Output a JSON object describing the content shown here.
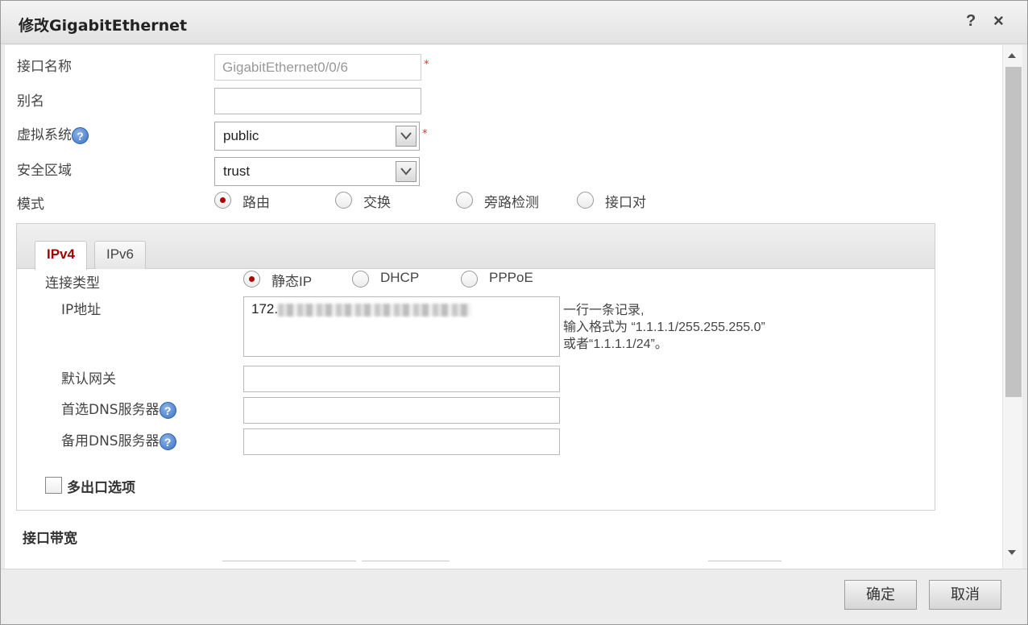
{
  "dialog": {
    "title": "修改GigabitEthernet",
    "help_label": "?",
    "close_label": "×"
  },
  "form": {
    "interface_name": {
      "label": "接口名称",
      "value": "GigabitEthernet0/0/6",
      "required_mark": "*"
    },
    "alias": {
      "label": "别名",
      "value": ""
    },
    "vsys": {
      "label": "虚拟系统",
      "value": "public",
      "required_mark": "*"
    },
    "zone": {
      "label": "安全区域",
      "value": "trust"
    },
    "mode": {
      "label": "模式",
      "options": [
        "路由",
        "交换",
        "旁路检测",
        "接口对"
      ],
      "selected": "路由"
    }
  },
  "ip_panel": {
    "tabs": [
      "IPv4",
      "IPv6"
    ],
    "active_tab": "IPv4",
    "conn_type": {
      "label": "连接类型",
      "options": [
        "静态IP",
        "DHCP",
        "PPPoE"
      ],
      "selected": "静态IP"
    },
    "ip_address": {
      "label": "IP地址",
      "value": "172.",
      "hint_line1": "一行一条记录,",
      "hint_line2": "输入格式为 “1.1.1.1/255.255.255.0”",
      "hint_line3": "或者“1.1.1.1/24”。"
    },
    "gateway": {
      "label": "默认网关",
      "value": ""
    },
    "dns_primary": {
      "label": "首选DNS服务器",
      "value": ""
    },
    "dns_backup": {
      "label": "备用DNS服务器",
      "value": ""
    },
    "multi_exit": {
      "label": "多出口选项",
      "checked": false
    }
  },
  "bandwidth": {
    "label": "接口带宽"
  },
  "help_icon_glyph": "?",
  "footer": {
    "ok_label": "确定",
    "cancel_label": "取消"
  }
}
